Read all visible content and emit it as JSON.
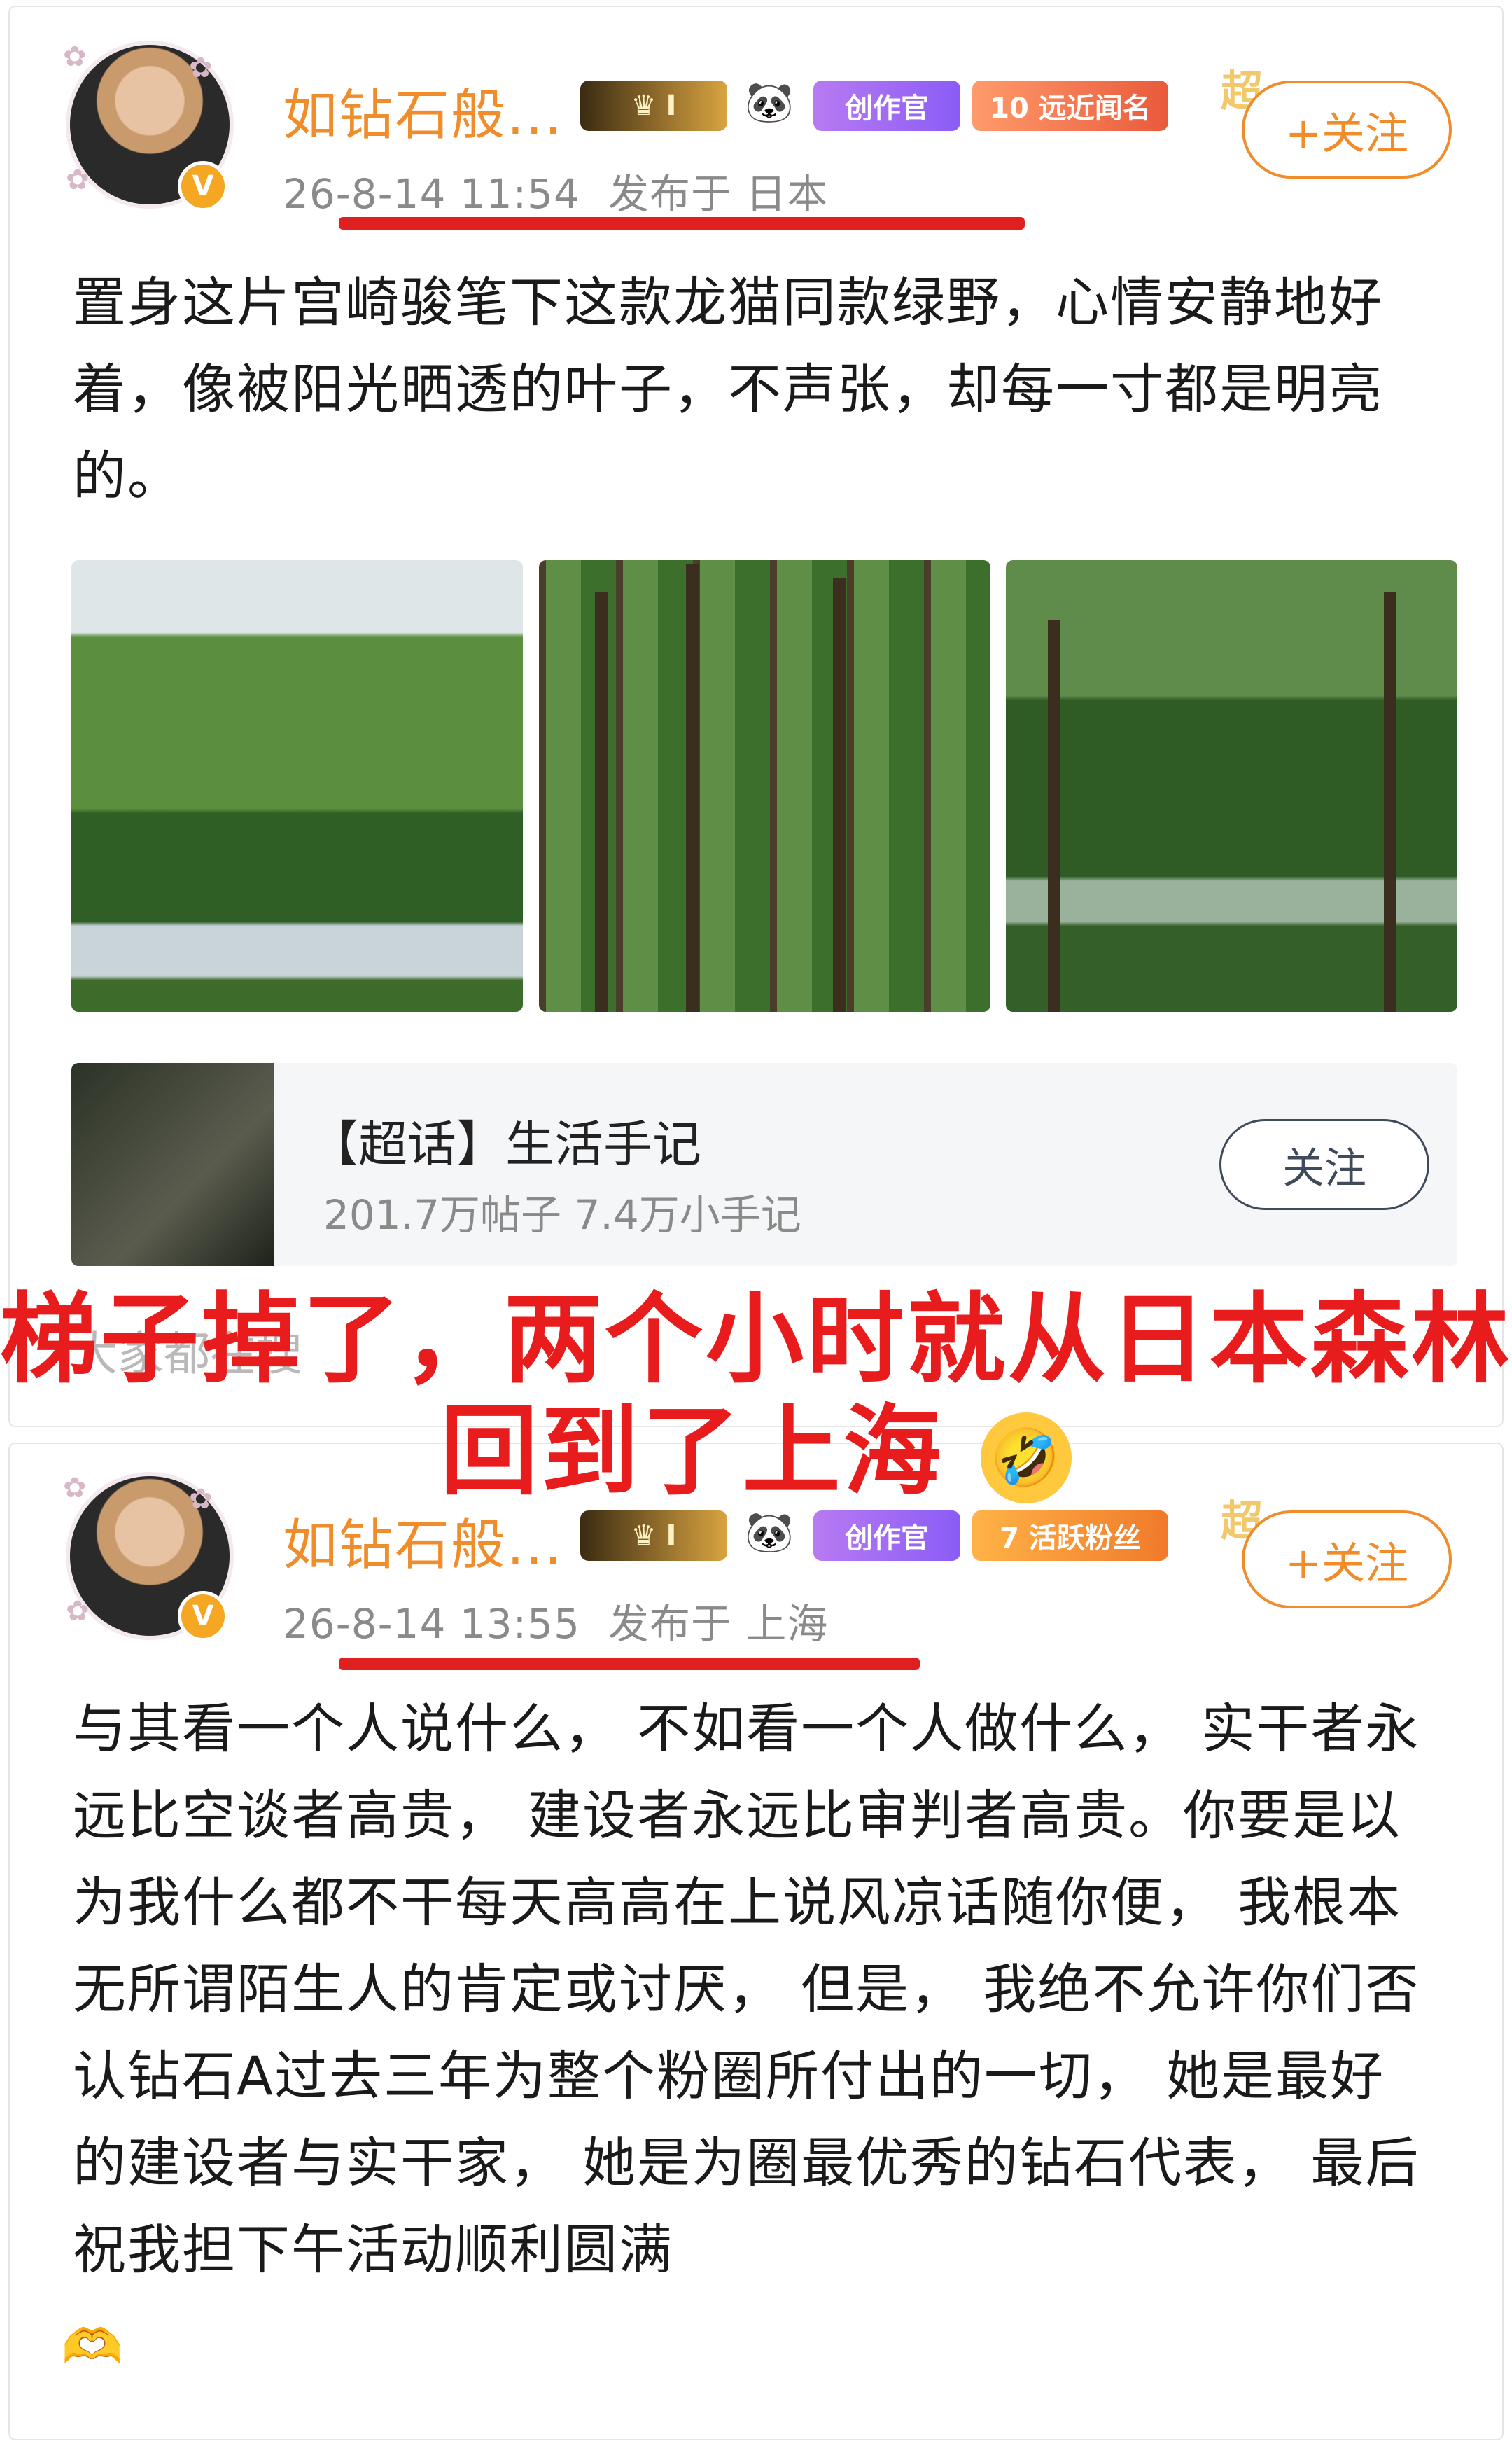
{
  "post1": {
    "username": "如钻石般...",
    "badge_crown": "I",
    "badge_create": "创作官",
    "badge_level": "10 远近闻名",
    "badge_super": "超",
    "follow": "+关注",
    "time": "26-8-14 11:54",
    "location": "发布于 日本",
    "text": "置身这片宫崎骏笔下这款龙猫同款绿野，心情安静地好着，像被阳光晒透的叶子，不声张，却每一寸都是明亮的。"
  },
  "topic": {
    "title": "【超话】生活手记",
    "stats": "201.7万帖子 7.4万小手记",
    "button": "关注"
  },
  "faded_text": "大家都在搜",
  "overlay": {
    "line1": "梯子掉了，两个小时就从日本森林",
    "line2": "回到了上海",
    "emoji": "🤣"
  },
  "post2": {
    "username": "如钻石般...",
    "badge_crown": "I",
    "badge_create": "创作官",
    "badge_level": "7 活跃粉丝",
    "badge_super": "超",
    "follow": "+关注",
    "time": "26-8-14 13:55",
    "location": "发布于 上海",
    "text": "与其看一个人说什么， 不如看一个人做什么， 实干者永远比空谈者高贵， 建设者永远比审判者高贵。你要是以为我什么都不干每天高高在上说风凉话随你便， 我根本无所谓陌生人的肯定或讨厌， 但是， 我绝不允许你们否认钻石A过去三年为整个粉圈所付出的一切， 她是最好的建设者与实干家， 她是为圈最优秀的钻石代表， 最后祝我担下午活动顺利圆满",
    "end_emoji": "🫶"
  },
  "colors": {
    "accent": "#f08c2a",
    "highlight": "#e02020",
    "overlay_text": "#e81c1c"
  }
}
